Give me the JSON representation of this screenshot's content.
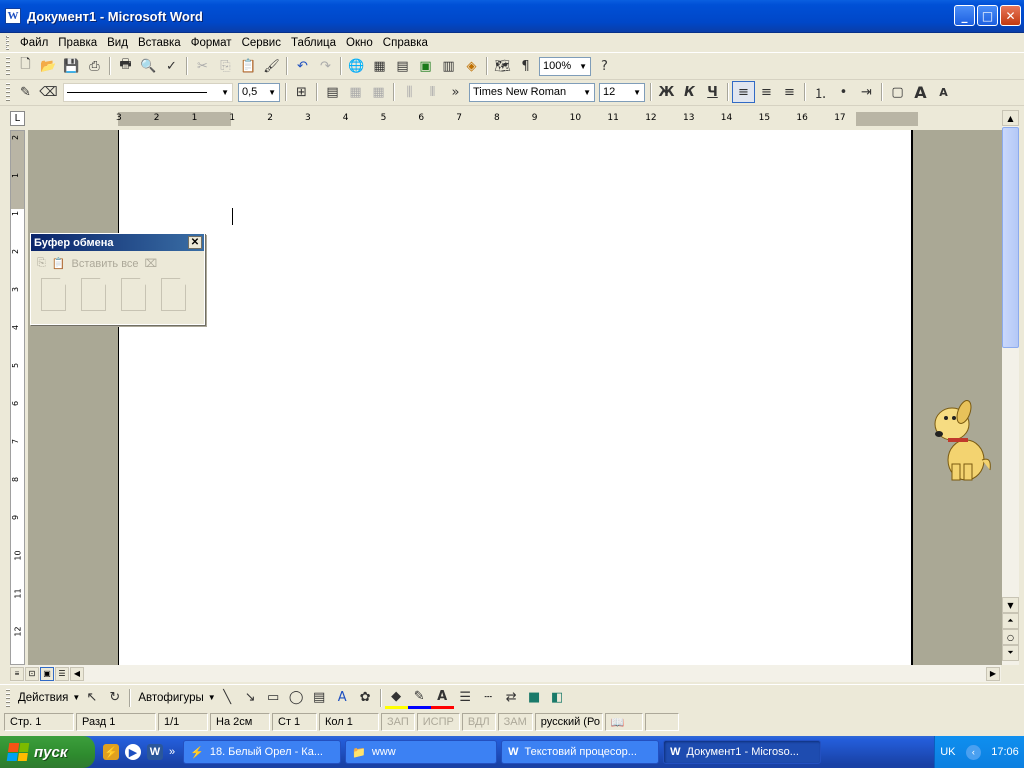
{
  "window": {
    "title": "Документ1 - Microsoft Word",
    "icon": "word-doc-icon"
  },
  "menu": [
    "Файл",
    "Правка",
    "Вид",
    "Вставка",
    "Формат",
    "Сервис",
    "Таблица",
    "Окно",
    "Справка"
  ],
  "toolbar_standard": {
    "zoom": "100%"
  },
  "toolbar_format": {
    "line_weight": "0,5",
    "font_name": "Times New Roman",
    "font_size": "12",
    "bold": "Ж",
    "italic": "К",
    "underline": "Ч"
  },
  "ruler": {
    "h_numbers": [
      "3",
      "2",
      "1",
      "1",
      "2",
      "3",
      "4",
      "5",
      "6",
      "7",
      "8",
      "9",
      "10",
      "11",
      "12",
      "13",
      "14",
      "15",
      "16",
      "17"
    ],
    "v_numbers": [
      "2",
      "1",
      "1",
      "2",
      "3",
      "4",
      "5",
      "6",
      "7",
      "8",
      "9",
      "10",
      "11",
      "12"
    ],
    "tab_marker": "L"
  },
  "clipboard": {
    "title": "Буфер обмена",
    "paste_all": "Вставить все",
    "close": "✕"
  },
  "drawing": {
    "actions": "Действия",
    "autoshapes": "Автофигуры"
  },
  "status": {
    "page": "Стр. 1",
    "section": "Разд 1",
    "pages": "1/1",
    "at": "На 2см",
    "line": "Ст 1",
    "col": "Кол 1",
    "rec": "ЗАП",
    "trk": "ИСПР",
    "ext": "ВДЛ",
    "ovr": "ЗАМ",
    "lang": "русский (Ро"
  },
  "taskbar": {
    "start": "пуск",
    "tasks": [
      {
        "label": "18. Белый Орел - Ка...",
        "icon": "winamp-icon"
      },
      {
        "label": "www",
        "icon": "folder-icon"
      },
      {
        "label": "Текстовий процесор...",
        "icon": "word-icon"
      },
      {
        "label": "Документ1 - Microso...",
        "icon": "word-icon"
      }
    ],
    "lang": "UK",
    "clock": "17:06"
  },
  "colors": {
    "titlebar": "#0050d6",
    "taskbar": "#245edb",
    "start": "#2e8b2e",
    "tray": "#0f8fef",
    "chrome": "#ece9d8"
  }
}
